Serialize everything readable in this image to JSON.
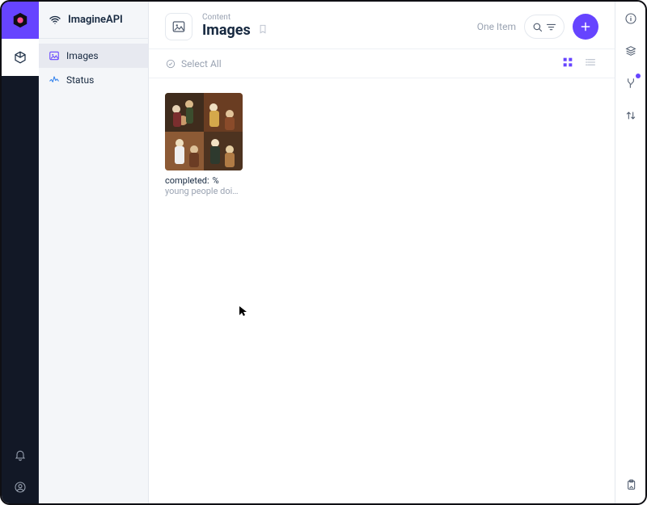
{
  "app": {
    "name": "ImagineAPI"
  },
  "nav": {
    "items": [
      {
        "label": "Images",
        "active": true
      },
      {
        "label": "Status",
        "active": false
      }
    ]
  },
  "header": {
    "crumb": "Content",
    "title": "Images",
    "item_count_label": "One Item"
  },
  "toolbar": {
    "select_all_label": "Select All"
  },
  "cards": [
    {
      "status_key": "completed:",
      "status_val": "%",
      "caption": "young people doin…"
    }
  ],
  "colors": {
    "accent": "#6644ff",
    "rail": "#121826",
    "muted": "#9aa3b2"
  }
}
